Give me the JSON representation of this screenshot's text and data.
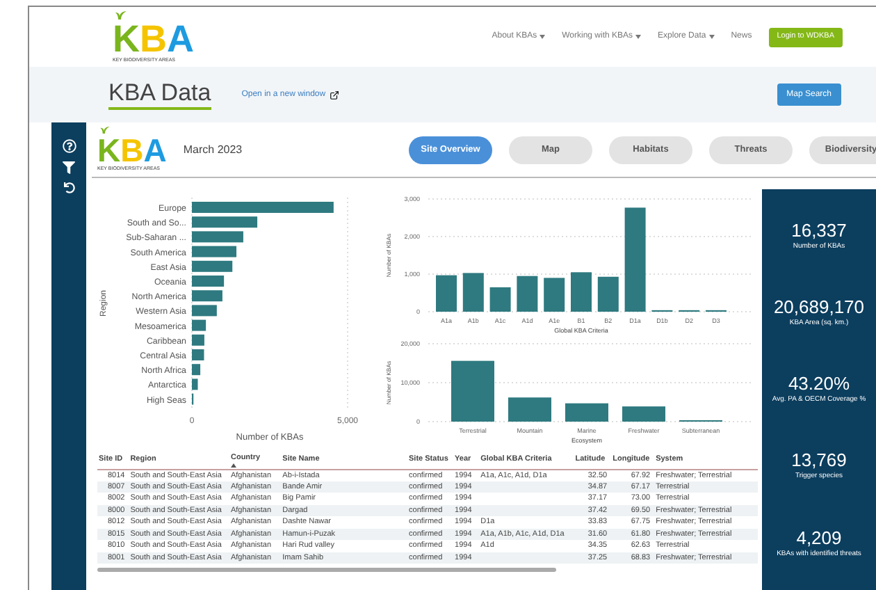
{
  "header": {
    "logo": {
      "letters": [
        {
          "text": "K",
          "color": "#7ab51d"
        },
        {
          "text": "B",
          "color": "#f5c400"
        },
        {
          "text": "A",
          "color": "#1e9be0"
        }
      ],
      "tagline": "KEY BIODIVERSITY AREAS"
    },
    "nav": [
      {
        "label": "About KBAs",
        "dropdown": true
      },
      {
        "label": "Working with KBAs",
        "dropdown": true
      },
      {
        "label": "Explore Data",
        "dropdown": true
      },
      {
        "label": "News",
        "dropdown": false
      }
    ],
    "login": "Login to WDKBA"
  },
  "page": {
    "title": "KBA Data",
    "open_link": "Open in a new window",
    "map_search": "Map Search"
  },
  "dashboard": {
    "logo": {
      "letters": [
        {
          "text": "K",
          "color": "#7ab51d"
        },
        {
          "text": "B",
          "color": "#f5c400"
        },
        {
          "text": "A",
          "color": "#1e9be0"
        }
      ],
      "tagline": "KEY BIODIVERSITY AREAS"
    },
    "date": "March 2023",
    "tabs": [
      {
        "label": "Site Overview",
        "selected": true
      },
      {
        "label": "Map",
        "selected": false
      },
      {
        "label": "Habitats",
        "selected": false
      },
      {
        "label": "Threats",
        "selected": false
      },
      {
        "label": "Biodiversity",
        "selected": false
      }
    ],
    "region_chart": {
      "chart_data": {
        "type": "bar",
        "orientation": "horizontal",
        "xlabel": "Number of KBAs",
        "ylabel": "Region",
        "categories": [
          "Europe",
          "South and So...",
          "Sub-Saharan ...",
          "South America",
          "East Asia",
          "Oceania",
          "North America",
          "Western Asia",
          "Mesoamerica",
          "Caribbean",
          "Central Asia",
          "North Africa",
          "Antarctica",
          "High Seas"
        ],
        "values": [
          4550,
          2100,
          1650,
          1430,
          1300,
          1030,
          980,
          800,
          450,
          400,
          390,
          270,
          190,
          50
        ],
        "xlim": [
          0,
          5000
        ],
        "xticks": [
          {
            "value": 0,
            "label": "0"
          },
          {
            "value": 5000,
            "label": "5,000"
          }
        ]
      }
    },
    "criteria_chart": {
      "chart_data": {
        "type": "bar",
        "xlabel": "Global KBA Criteria",
        "ylabel": "Number of KBAs",
        "categories": [
          "A1a",
          "A1b",
          "A1c",
          "A1d",
          "A1e",
          "B1",
          "B2",
          "D1a",
          "D1b",
          "D2",
          "D3"
        ],
        "values": [
          970,
          1030,
          650,
          950,
          900,
          1050,
          930,
          2770,
          40,
          40,
          40
        ],
        "ylim": [
          0,
          3000
        ],
        "yticks": [
          {
            "value": 0,
            "label": "0"
          },
          {
            "value": 1000,
            "label": "1,000"
          },
          {
            "value": 2000,
            "label": "2,000"
          },
          {
            "value": 3000,
            "label": "3,000"
          }
        ]
      }
    },
    "ecosystem_chart": {
      "chart_data": {
        "type": "bar",
        "xlabel": "Ecosystem",
        "ylabel": "Number of KBAs",
        "categories": [
          "Terrestrial",
          "Mountain",
          "Marine",
          "Freshwater",
          "Subterranean"
        ],
        "values": [
          15600,
          6200,
          4700,
          3900,
          200
        ],
        "ylim": [
          0,
          20000
        ],
        "yticks": [
          {
            "value": 0,
            "label": "0"
          },
          {
            "value": 10000,
            "label": "10,000"
          },
          {
            "value": 20000,
            "label": "20,000"
          }
        ]
      }
    },
    "table": {
      "columns": [
        {
          "label": "Site ID",
          "sorted": false
        },
        {
          "label": "Region",
          "sorted": false
        },
        {
          "label": "Country",
          "sorted": true
        },
        {
          "label": "Site Name",
          "sorted": false
        },
        {
          "label": "Site Status",
          "sorted": false
        },
        {
          "label": "Year",
          "sorted": false
        },
        {
          "label": "Global KBA Criteria",
          "sorted": false
        },
        {
          "label": "Latitude",
          "sorted": false
        },
        {
          "label": "Longitude",
          "sorted": false
        },
        {
          "label": "System",
          "sorted": false
        }
      ],
      "rows": [
        [
          "8014",
          "South and South-East Asia",
          "Afghanistan",
          "Ab-i-Istada",
          "confirmed",
          "1994",
          "A1a, A1c, A1d, D1a",
          "32.50",
          "67.92",
          "Freshwater; Terrestrial"
        ],
        [
          "8007",
          "South and South-East Asia",
          "Afghanistan",
          "Bande Amir",
          "confirmed",
          "1994",
          null,
          "34.87",
          "67.17",
          "Terrestrial"
        ],
        [
          "8002",
          "South and South-East Asia",
          "Afghanistan",
          "Big Pamir",
          "confirmed",
          "1994",
          null,
          "37.17",
          "73.00",
          "Terrestrial"
        ],
        [
          "8000",
          "South and South-East Asia",
          "Afghanistan",
          "Dargad",
          "confirmed",
          "1994",
          null,
          "37.42",
          "69.50",
          "Freshwater; Terrestrial"
        ],
        [
          "8012",
          "South and South-East Asia",
          "Afghanistan",
          "Dashte Nawar",
          "confirmed",
          "1994",
          "D1a",
          "33.83",
          "67.75",
          "Freshwater; Terrestrial"
        ],
        [
          "8015",
          "South and South-East Asia",
          "Afghanistan",
          "Hamun-i-Puzak",
          "confirmed",
          "1994",
          "A1a, A1b, A1c, A1d, D1a",
          "31.60",
          "61.80",
          "Freshwater; Terrestrial"
        ],
        [
          "8010",
          "South and South-East Asia",
          "Afghanistan",
          "Hari Rud valley",
          "confirmed",
          "1994",
          "A1d",
          "34.35",
          "62.63",
          "Terrestrial"
        ],
        [
          "8001",
          "South and South-East Asia",
          "Afghanistan",
          "Imam Sahib",
          "confirmed",
          "1994",
          null,
          "37.25",
          "68.83",
          "Freshwater; Terrestrial"
        ]
      ]
    },
    "kpis": [
      {
        "value": "16,337",
        "label": "Number of KBAs"
      },
      {
        "value": "20,689,170",
        "label": "KBA Area (sq. km.)"
      },
      {
        "value": "43.20%",
        "label": "Avg. PA & OECM Coverage %"
      },
      {
        "value": "13,769",
        "label": "Trigger species"
      },
      {
        "value": "4,209",
        "label": "KBAs with identified threats"
      }
    ]
  }
}
